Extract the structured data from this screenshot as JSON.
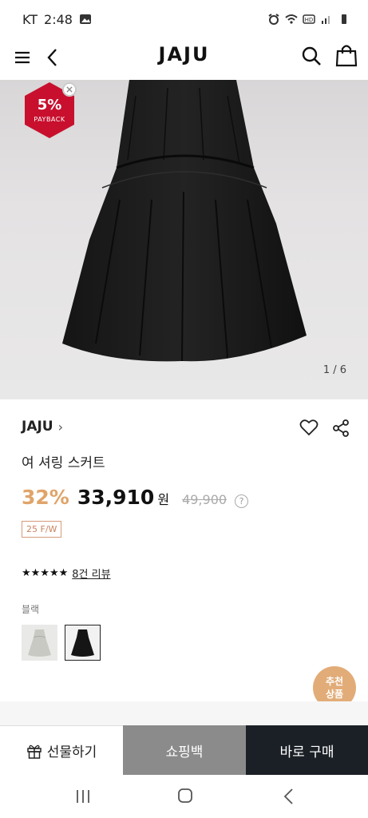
{
  "status_bar": {
    "carrier": "KT",
    "time": "2:48"
  },
  "header": {
    "logo": "JAJU"
  },
  "hero": {
    "badge_percent": "5%",
    "badge_label": "PAYBACK",
    "pager": "1 / 6"
  },
  "product": {
    "brand": "JAJU",
    "brand_chevron": "›",
    "title": "여 셔링 스커트",
    "discount": "32%",
    "price": "33,910",
    "currency": "원",
    "original_price": "49,900",
    "help": "?",
    "season": "25 F/W",
    "stars": "★★★★★",
    "rating_value": 5,
    "review_link": "8건 리뷰",
    "color_label": "블랙"
  },
  "recommend": {
    "label_line1": "추천",
    "label_line2": "상품"
  },
  "actions": {
    "gift": "선물하기",
    "cart": "쇼핑백",
    "buy": "바로 구매"
  },
  "colors": {
    "accent": "#e0a46a",
    "badge": "#c8102e",
    "buy_button": "#1b2026",
    "cart_button": "#8b8b8b"
  },
  "icons": [
    "menu-icon",
    "back-icon",
    "search-icon",
    "shopping-bag-icon",
    "heart-icon",
    "share-icon",
    "gift-icon",
    "close-icon"
  ]
}
